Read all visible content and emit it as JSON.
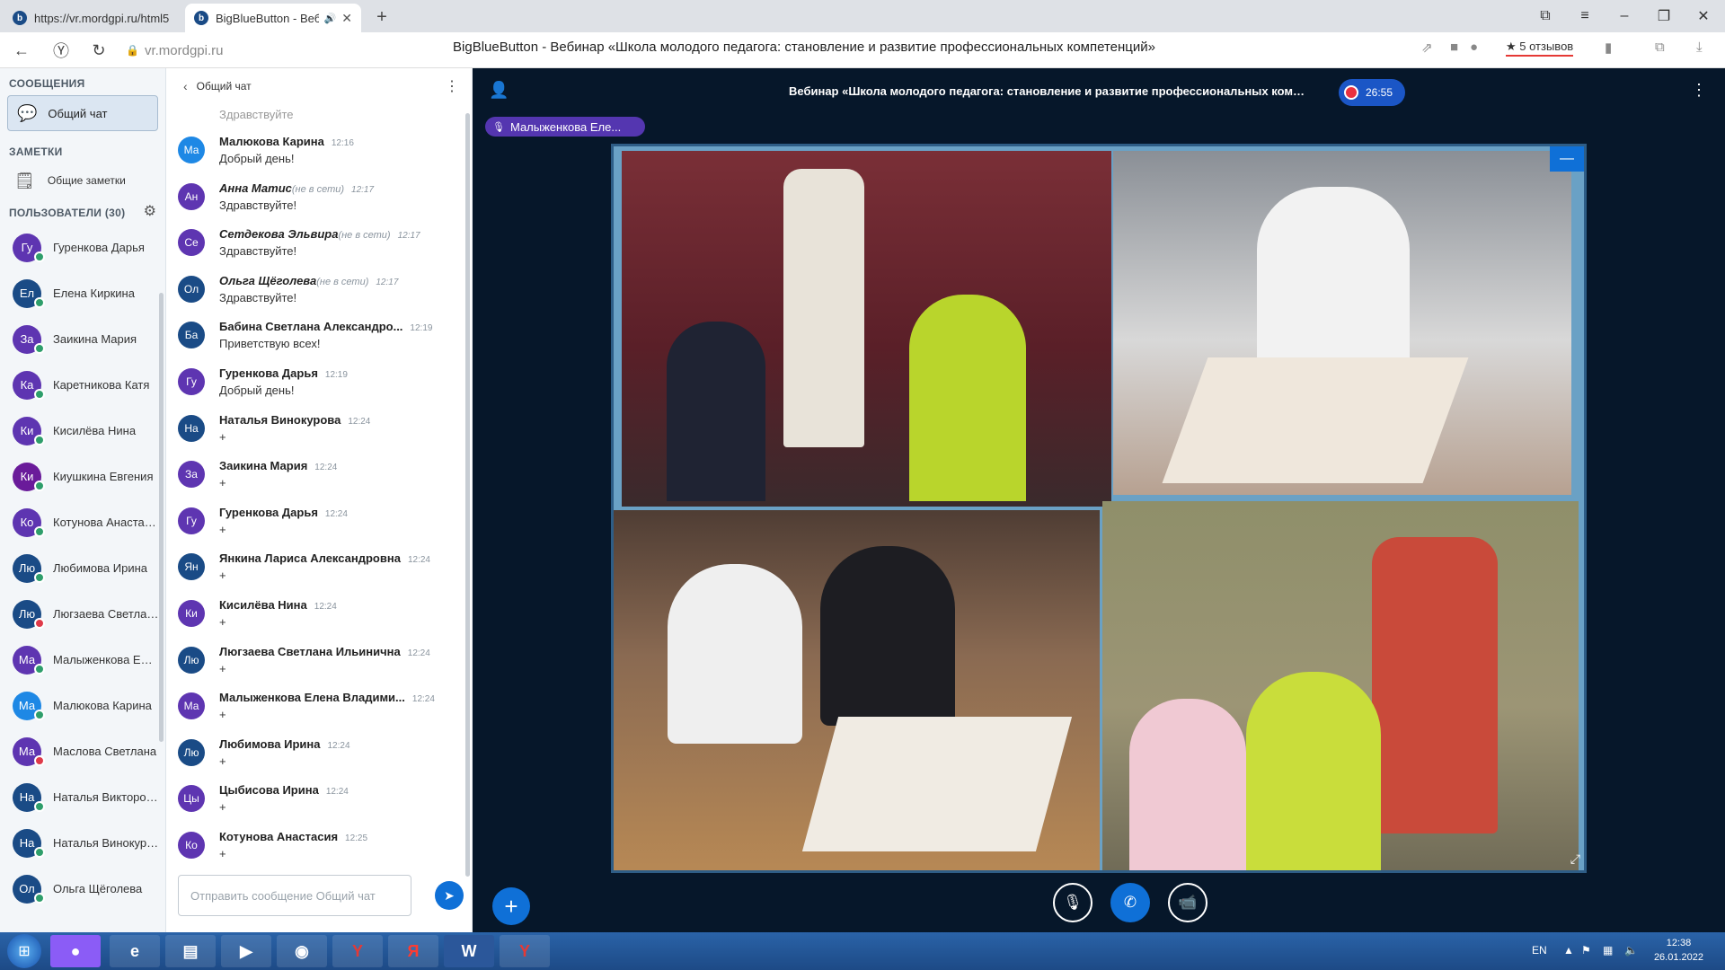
{
  "browser": {
    "tabs": [
      {
        "label": "https://vr.mordgpi.ru/html5"
      },
      {
        "label": "BigBlueButton - Веб"
      }
    ],
    "tab_favicon": "b",
    "url": "vr.mordgpi.ru",
    "page_title": "BigBlueButton - Вебинар «Школа молодого педагога: становление и развитие профессиональных компетенций»",
    "reviews": "★ 5 отзывов"
  },
  "sidebar": {
    "messages_title": "СООБЩЕНИЯ",
    "public_chat": "Общий чат",
    "notes_title": "ЗАМЕТКИ",
    "shared_notes": "Общие заметки",
    "users_title": "ПОЛЬЗОВАТЕЛИ (30)",
    "users": [
      {
        "initials": "Гу",
        "name": "Гуренкова Дарья",
        "color": "#5e35b1",
        "status": "ok"
      },
      {
        "initials": "Ел",
        "name": "Елена Киркина",
        "color": "#1a4b86",
        "status": "ok"
      },
      {
        "initials": "За",
        "name": "Заикина Мария",
        "color": "#5e35b1",
        "status": "ok"
      },
      {
        "initials": "Ка",
        "name": "Каретникова Катя",
        "color": "#5e35b1",
        "status": "ok"
      },
      {
        "initials": "Ки",
        "name": "Кисилёва Нина",
        "color": "#5e35b1",
        "status": "ok"
      },
      {
        "initials": "Ки",
        "name": "Киушкина Евгения",
        "color": "#6a1b9a",
        "status": "ok"
      },
      {
        "initials": "Ко",
        "name": "Котунова Анастасия",
        "color": "#5e35b1",
        "status": "ok"
      },
      {
        "initials": "Лю",
        "name": "Любимова Ирина",
        "color": "#1a4b86",
        "status": "ok"
      },
      {
        "initials": "Лю",
        "name": "Люгзаева Светлана",
        "color": "#1a4b86",
        "status": "muted"
      },
      {
        "initials": "Ма",
        "name": "Малыженкова Елена",
        "color": "#5e35b1",
        "status": "ok"
      },
      {
        "initials": "Ма",
        "name": "Малюкова Карина",
        "color": "#1e88e5",
        "status": "ok"
      },
      {
        "initials": "Ма",
        "name": "Маслова Светлана",
        "color": "#5e35b1",
        "status": "muted"
      },
      {
        "initials": "На",
        "name": "Наталья Викторовна",
        "color": "#1a4b86",
        "status": "ok"
      },
      {
        "initials": "На",
        "name": "Наталья Винокурова",
        "color": "#1a4b86",
        "status": "ok"
      },
      {
        "initials": "Ол",
        "name": "Ольга Щёголева",
        "color": "#1a4b86",
        "status": "ok"
      }
    ]
  },
  "chat": {
    "header": "Общий чат",
    "partial_text": "Здравствуйте",
    "messages": [
      {
        "initials": "Ма",
        "color": "#1e88e5",
        "name": "Малюкова Карина",
        "offline": "",
        "time": "12:16",
        "text": "Добрый день!"
      },
      {
        "initials": "Ан",
        "color": "#5e35b1",
        "name": "Анна Матис",
        "offline": "(не в сети)",
        "time": "12:17",
        "text": "Здравствуйте!"
      },
      {
        "initials": "Се",
        "color": "#5e35b1",
        "name": "Сетдекова Эльвира",
        "offline": "(не в сети)",
        "time": "12:17",
        "text": "Здравствуйте!"
      },
      {
        "initials": "Ол",
        "color": "#1a4b86",
        "name": "Ольга Щёголева",
        "offline": "(не в сети)",
        "time": "12:17",
        "text": "Здравствуйте!"
      },
      {
        "initials": "Ба",
        "color": "#1a4b86",
        "name": "Бабина Светлана Александро...",
        "offline": "",
        "time": "12:19",
        "text": "Приветствую всех!"
      },
      {
        "initials": "Гу",
        "color": "#5e35b1",
        "name": "Гуренкова Дарья",
        "offline": "",
        "time": "12:19",
        "text": "Добрый день!"
      },
      {
        "initials": "На",
        "color": "#1a4b86",
        "name": "Наталья Винокурова",
        "offline": "",
        "time": "12:24",
        "text": "+"
      },
      {
        "initials": "За",
        "color": "#5e35b1",
        "name": "Заикина Мария",
        "offline": "",
        "time": "12:24",
        "text": "+"
      },
      {
        "initials": "Гу",
        "color": "#5e35b1",
        "name": "Гуренкова Дарья",
        "offline": "",
        "time": "12:24",
        "text": "+"
      },
      {
        "initials": "Ян",
        "color": "#1a4b86",
        "name": "Янкина Лариса Александровна",
        "offline": "",
        "time": "12:24",
        "text": "+"
      },
      {
        "initials": "Ки",
        "color": "#5e35b1",
        "name": "Кисилёва Нина",
        "offline": "",
        "time": "12:24",
        "text": "+"
      },
      {
        "initials": "Лю",
        "color": "#1a4b86",
        "name": "Люгзаева Светлана Ильинична",
        "offline": "",
        "time": "12:24",
        "text": "+"
      },
      {
        "initials": "Ма",
        "color": "#5e35b1",
        "name": "Малыженкова Елена Владими...",
        "offline": "",
        "time": "12:24",
        "text": "+"
      },
      {
        "initials": "Лю",
        "color": "#1a4b86",
        "name": "Любимова Ирина",
        "offline": "",
        "time": "12:24",
        "text": "+"
      },
      {
        "initials": "Цы",
        "color": "#5e35b1",
        "name": "Цыбисова Ирина",
        "offline": "",
        "time": "12:24",
        "text": "+"
      },
      {
        "initials": "Ко",
        "color": "#5e35b1",
        "name": "Котунова Анастасия",
        "offline": "",
        "time": "12:25",
        "text": "+"
      }
    ],
    "input_placeholder": "Отправить сообщение Общий чат"
  },
  "main": {
    "meeting_title": "Вебинар «Школа молодого педагога: становление и развитие профессиональных компетенций»",
    "timer": "26:55",
    "talker": "Малыженкова Еле..."
  },
  "taskbar": {
    "lang": "EN",
    "time": "12:38",
    "date": "26.01.2022"
  },
  "colors": {
    "accent": "#0f70d7",
    "main_bg": "#06172a",
    "talker_bg": "#5436b0",
    "status_online": "#2e9e6b",
    "status_muted": "#df3a4a"
  }
}
